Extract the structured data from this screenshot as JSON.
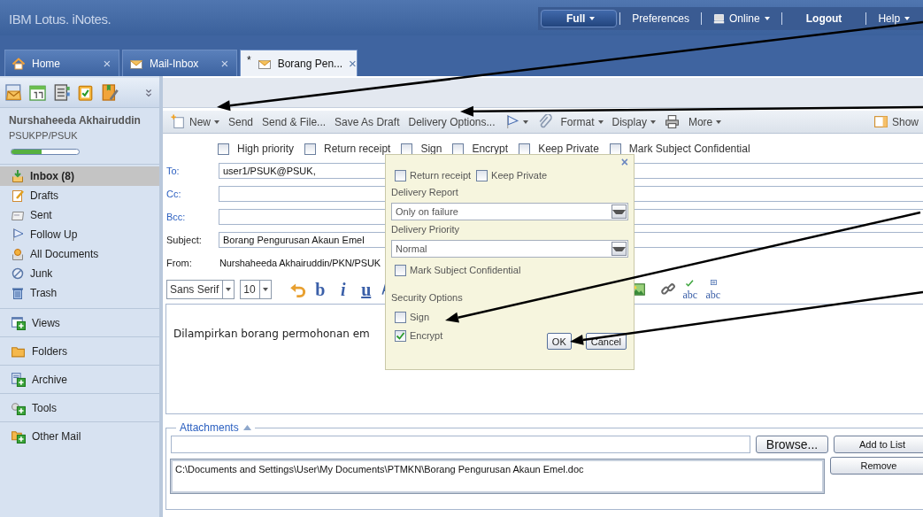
{
  "app": {
    "title": "IBM Lotus. iNotes."
  },
  "header_nav": [
    {
      "kind": "pill",
      "label": "Full"
    },
    {
      "kind": "link",
      "label": "Preferences"
    },
    {
      "kind": "status",
      "label": "Online"
    },
    {
      "kind": "action",
      "label": "Logout"
    },
    {
      "kind": "menu",
      "label": "Help"
    }
  ],
  "tabs": [
    {
      "label": "Home",
      "close": "×",
      "selected": false
    },
    {
      "label": "Mail-Inbox",
      "close": "×",
      "selected": false
    },
    {
      "marker": "*",
      "label": "Borang Pen...",
      "close": "×",
      "selected": true
    }
  ],
  "sidebar": {
    "user_name": "Nurshaheeda Akhairuddin",
    "org": "PSUKPP/PSUK",
    "quota": {
      "level": 0.45
    },
    "folders": [
      {
        "label": "Inbox (8)",
        "selected": true
      },
      {
        "label": "Drafts",
        "selected": false
      },
      {
        "label": "Sent",
        "selected": false
      },
      {
        "label": "Follow Up",
        "selected": false
      },
      {
        "label": "All Documents",
        "selected": false
      },
      {
        "label": "Junk",
        "selected": false
      },
      {
        "label": "Trash",
        "selected": false
      }
    ],
    "sections": [
      {
        "label": "Views"
      },
      {
        "label": "Folders"
      },
      {
        "label": "Archive"
      },
      {
        "label": "Tools"
      },
      {
        "label": "Other Mail"
      }
    ]
  },
  "toolbar": [
    {
      "kind": "icon_label",
      "label": "New",
      "dropdown": true
    },
    {
      "kind": "label",
      "label": "Send",
      "dropdown": false
    },
    {
      "kind": "label",
      "label": "Send & File...",
      "dropdown": false
    },
    {
      "kind": "label",
      "label": "Save As Draft",
      "dropdown": false
    },
    {
      "kind": "label",
      "label": "Delivery Options...",
      "dropdown": false
    },
    {
      "kind": "icon",
      "dropdown": true
    },
    {
      "kind": "icon",
      "dropdown": false
    },
    {
      "kind": "label",
      "label": "Format",
      "dropdown": true
    },
    {
      "kind": "label",
      "label": "Display",
      "dropdown": true
    },
    {
      "kind": "icon",
      "dropdown": false
    },
    {
      "kind": "label",
      "label": "More",
      "dropdown": true
    }
  ],
  "toolbar_right": {
    "label": "Show"
  },
  "options": [
    {
      "label": "High priority",
      "checked": false
    },
    {
      "label": "Return receipt",
      "checked": false
    },
    {
      "label": "Sign",
      "checked": false
    },
    {
      "label": "Encrypt",
      "checked": false
    },
    {
      "label": "Keep Private",
      "checked": false
    },
    {
      "label": "Mark Subject Confidential",
      "checked": false
    }
  ],
  "fields": [
    {
      "kind": "address",
      "label": "To:",
      "value": "user1/PSUK@PSUK,"
    },
    {
      "kind": "address",
      "label": "Cc:"
    },
    {
      "kind": "address",
      "label": "Bcc:"
    },
    {
      "kind": "input",
      "label": "Subject:",
      "value": "Borang Pengurusan Akaun Emel"
    },
    {
      "kind": "static",
      "label": "From:",
      "value": "Nurshaheeda Akhairuddin/PKN/PSUK"
    }
  ],
  "editor": {
    "font": "Sans Serif",
    "size": "10",
    "style_buttons": [
      {
        "label": "b"
      },
      {
        "label": "i"
      },
      {
        "label": "u"
      }
    ],
    "spell_buttons": [
      {
        "label": "abc"
      },
      {
        "label": "abc"
      }
    ],
    "body": "Dilampirkan borang permohonan em"
  },
  "attachments": {
    "legend": "Attachments",
    "browse": "Browse...",
    "add": "Add to List",
    "remove": "Remove",
    "files": [
      "C:\\Documents and Settings\\User\\My Documents\\PTMKN\\Borang Pengurusan Akaun Emel.doc"
    ]
  },
  "popup": {
    "close": "×",
    "checks": [
      {
        "label": "Return receipt",
        "checked": false
      },
      {
        "label": "Keep Private",
        "checked": false
      }
    ],
    "delivery_report": {
      "label": "Delivery Report",
      "value": "Only on failure"
    },
    "delivery_priority": {
      "label": "Delivery Priority",
      "value": "Normal"
    },
    "confidential": {
      "label": "Mark Subject Confidential",
      "checked": false
    },
    "security_title": "Security Options",
    "security": [
      {
        "label": "Sign",
        "checked": false
      },
      {
        "label": "Encrypt",
        "checked": true
      }
    ],
    "ok": "OK",
    "cancel": "Cancel"
  }
}
